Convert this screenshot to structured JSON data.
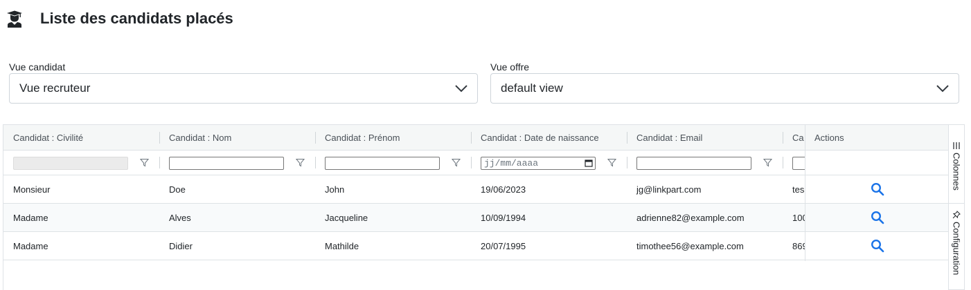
{
  "header": {
    "icon": "graduation-cap-icon",
    "title": "Liste des candidats placés"
  },
  "filters": {
    "candidate_view": {
      "label": "Vue candidat",
      "value": "Vue recruteur"
    },
    "offer_view": {
      "label": "Vue offre",
      "value": "default view"
    }
  },
  "grid": {
    "columns": [
      "Candidat : Civilité",
      "Candidat : Nom",
      "Candidat : Prénom",
      "Candidat : Date de naissance",
      "Candidat : Email",
      "Ca"
    ],
    "actions_header": "Actions",
    "date_placeholder": "jj/mm/aaaa",
    "rows": [
      {
        "civilite": "Monsieur",
        "nom": "Doe",
        "prenom": "John",
        "naissance": "19/06/2023",
        "email": "jg@linkpart.com",
        "extra": "tes"
      },
      {
        "civilite": "Madame",
        "nom": "Alves",
        "prenom": "Jacqueline",
        "naissance": "10/09/1994",
        "email": "adrienne82@example.com",
        "extra": "100"
      },
      {
        "civilite": "Madame",
        "nom": "Didier",
        "prenom": "Mathilde",
        "naissance": "20/07/1995",
        "email": "timothee56@example.com",
        "extra": "869"
      }
    ]
  },
  "side_panel": {
    "columns_tab": "Colonnes",
    "config_tab": "Configuration"
  },
  "colors": {
    "accent": "#1a73e8",
    "header_bg": "#f5f7f7",
    "border": "#dee2e6"
  }
}
